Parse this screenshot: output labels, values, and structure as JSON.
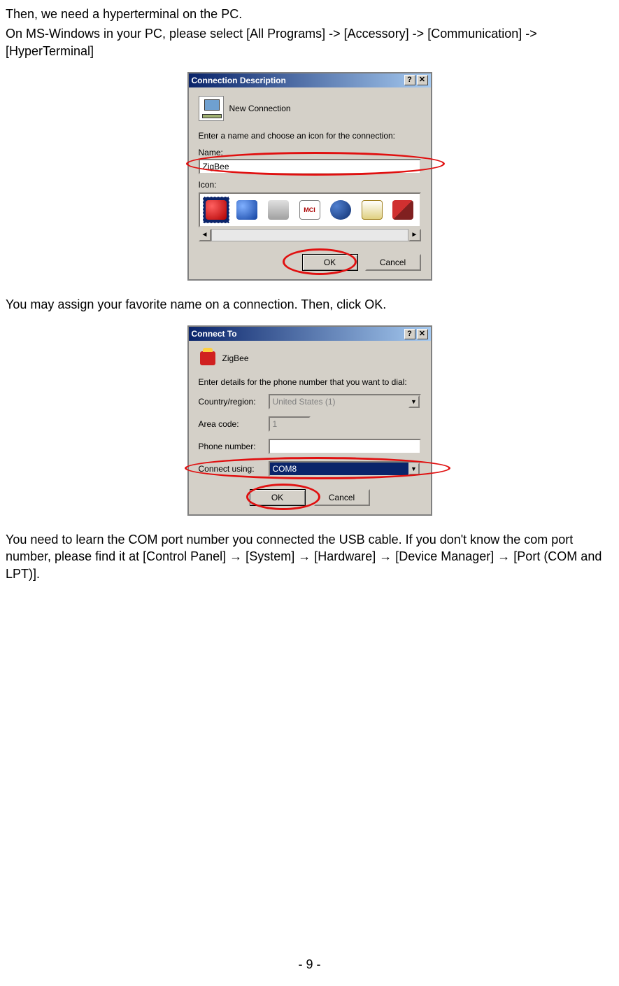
{
  "para1_line1": "Then, we need a hyperterminal on the PC.",
  "para1_line2": "On MS-Windows in your PC, please select [All Programs] -> [Accessory] -> [Communication] -> [HyperTerminal]",
  "dialog1": {
    "title": "Connection Description",
    "new_connection": "New Connection",
    "prompt": "Enter a name and choose an icon for the connection:",
    "name_label": "Name:",
    "name_value": "ZigBee",
    "icon_label": "Icon:",
    "mci": "MCI",
    "ok": "OK",
    "cancel": "Cancel"
  },
  "para2": "You may assign your favorite name on a connection. Then, click OK.",
  "dialog2": {
    "title": "Connect To",
    "name": "ZigBee",
    "prompt": "Enter details for the phone number that you want to dial:",
    "country_label": "Country/region:",
    "country_value": "United States (1)",
    "area_label": "Area code:",
    "area_value": "1",
    "phone_label": "Phone number:",
    "phone_value": "",
    "connect_label": "Connect using:",
    "connect_value": "COM8",
    "ok": "OK",
    "cancel": "Cancel"
  },
  "para3": "You need to learn the COM port number you connected the USB cable. If you don't know the com port number, please find it at [Control Panel] → [System] → [Hardware] → [Device Manager] → [Port (COM and LPT)].",
  "page_number": "- 9 -"
}
